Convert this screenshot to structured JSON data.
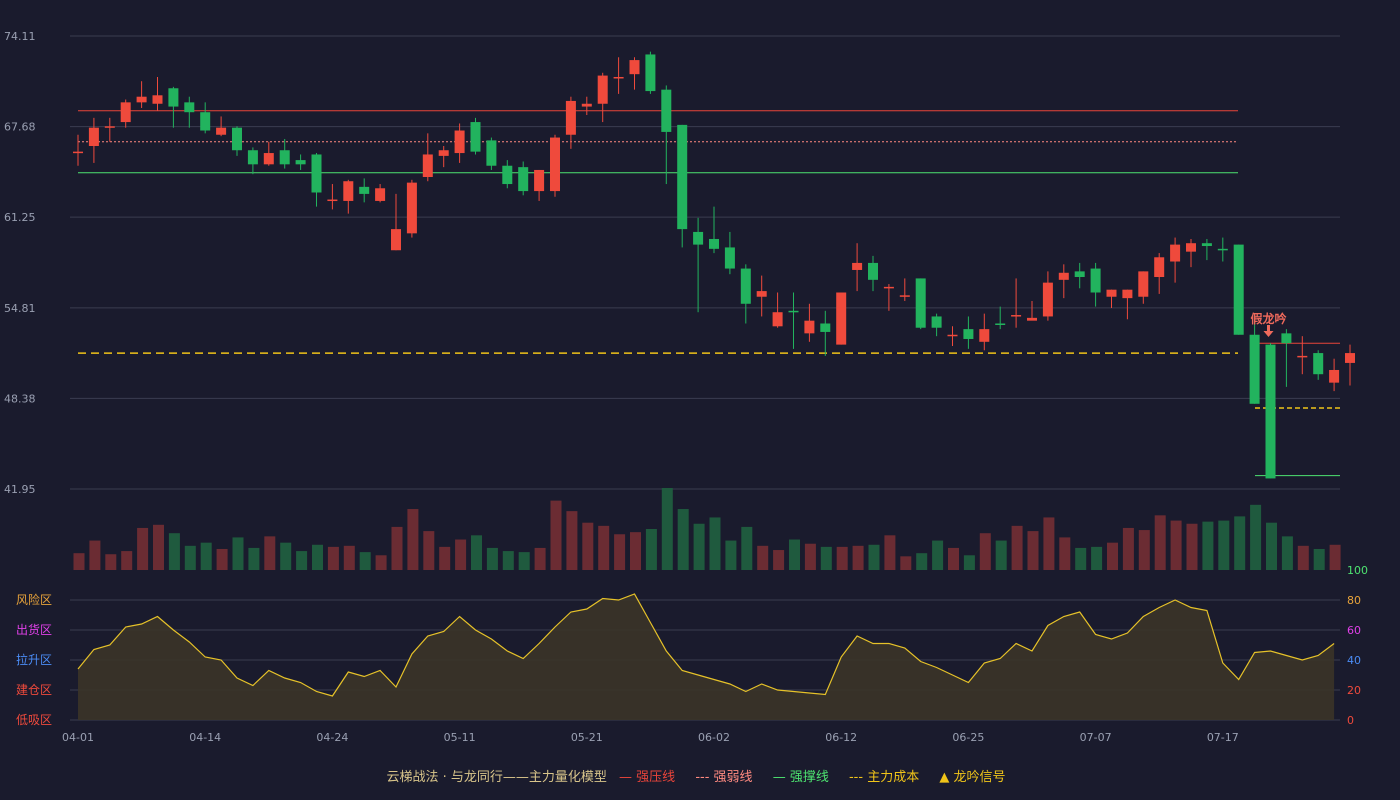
{
  "colors": {
    "background": "#1a1b2d",
    "grid": "#3a3c50",
    "up": "#ef4a3c",
    "down": "#22b35e",
    "pressure_line": "#e8443a",
    "weak_line": "#ff8a80",
    "support_line": "#4de370",
    "cost_line": "#f0c419",
    "indicator_line": "#e6c229",
    "indicator_fill": "#3b3428"
  },
  "chart_data": {
    "type": "candlestick",
    "price_ticks": [
      "74.11",
      "67.68",
      "61.25",
      "54.81",
      "48.38",
      "41.95"
    ],
    "ylim": [
      41.95,
      74.11
    ],
    "x_ticks": [
      {
        "index": 0,
        "label": "04-01"
      },
      {
        "index": 8,
        "label": "04-14"
      },
      {
        "index": 16,
        "label": "04-24"
      },
      {
        "index": 24,
        "label": "05-11"
      },
      {
        "index": 32,
        "label": "05-21"
      },
      {
        "index": 40,
        "label": "06-02"
      },
      {
        "index": 48,
        "label": "06-12"
      },
      {
        "index": 56,
        "label": "06-25"
      },
      {
        "index": 64,
        "label": "07-07"
      },
      {
        "index": 72,
        "label": "07-17"
      }
    ],
    "candles": [
      [
        65.9,
        65.9,
        67.1,
        64.9
      ],
      [
        66.3,
        67.6,
        68.3,
        65.1
      ],
      [
        67.6,
        67.7,
        68.3,
        66.6
      ],
      [
        68.0,
        69.4,
        69.6,
        67.6
      ],
      [
        69.4,
        69.8,
        70.9,
        69.0
      ],
      [
        69.3,
        69.9,
        71.2,
        68.8
      ],
      [
        70.4,
        69.1,
        70.5,
        67.6
      ],
      [
        69.4,
        68.7,
        69.8,
        67.6
      ],
      [
        68.7,
        67.4,
        69.4,
        67.2
      ],
      [
        67.1,
        67.6,
        68.4,
        67.0
      ],
      [
        67.6,
        66.0,
        67.7,
        65.6
      ],
      [
        66.0,
        65.0,
        66.2,
        64.3
      ],
      [
        65.0,
        65.8,
        66.6,
        64.9
      ],
      [
        66.0,
        65.0,
        66.8,
        64.7
      ],
      [
        65.3,
        65.0,
        65.7,
        64.6
      ],
      [
        65.7,
        63.0,
        65.8,
        62.0
      ],
      [
        62.4,
        62.5,
        63.6,
        61.8
      ],
      [
        62.4,
        63.8,
        63.9,
        61.5
      ],
      [
        63.4,
        62.9,
        64.0,
        62.3
      ],
      [
        62.4,
        63.3,
        63.6,
        62.3
      ],
      [
        58.9,
        60.4,
        62.9,
        58.9
      ],
      [
        60.1,
        63.7,
        63.9,
        59.8
      ],
      [
        64.1,
        65.7,
        67.2,
        63.8
      ],
      [
        65.6,
        66.0,
        66.3,
        64.8
      ],
      [
        65.8,
        67.4,
        67.9,
        65.1
      ],
      [
        68.0,
        65.9,
        68.3,
        65.7
      ],
      [
        66.7,
        64.9,
        66.9,
        64.6
      ],
      [
        64.9,
        63.6,
        65.3,
        63.3
      ],
      [
        64.8,
        63.1,
        65.2,
        62.8
      ],
      [
        63.1,
        64.6,
        64.6,
        62.4
      ],
      [
        63.1,
        66.9,
        67.1,
        62.7
      ],
      [
        67.1,
        69.5,
        69.8,
        66.1
      ],
      [
        69.1,
        69.3,
        69.8,
        68.5
      ],
      [
        69.3,
        71.3,
        71.5,
        68.0
      ],
      [
        71.2,
        71.2,
        72.6,
        70.0
      ],
      [
        71.4,
        72.4,
        72.6,
        70.3
      ],
      [
        72.8,
        70.2,
        73.0,
        70.0
      ],
      [
        70.3,
        67.3,
        70.6,
        63.6
      ],
      [
        67.8,
        60.4,
        67.8,
        59.1
      ],
      [
        60.2,
        59.3,
        61.2,
        54.5
      ],
      [
        59.7,
        59.0,
        62.0,
        58.7
      ],
      [
        59.1,
        57.6,
        60.2,
        57.2
      ],
      [
        57.6,
        55.1,
        57.9,
        53.7
      ],
      [
        55.6,
        56.0,
        57.1,
        54.2
      ],
      [
        53.5,
        54.5,
        55.9,
        53.4
      ],
      [
        54.6,
        54.5,
        55.9,
        51.9
      ],
      [
        53.0,
        53.9,
        55.1,
        52.4
      ],
      [
        53.7,
        53.1,
        54.6,
        51.4
      ],
      [
        52.2,
        55.9,
        55.9,
        52.2
      ],
      [
        57.5,
        58.0,
        59.4,
        56.0
      ],
      [
        58.0,
        56.8,
        58.5,
        56.0
      ],
      [
        56.2,
        56.3,
        56.5,
        54.6
      ],
      [
        55.6,
        55.7,
        56.9,
        55.3
      ],
      [
        56.9,
        53.4,
        56.9,
        53.3
      ],
      [
        54.2,
        53.4,
        54.4,
        52.8
      ],
      [
        52.8,
        52.9,
        53.5,
        52.1
      ],
      [
        53.3,
        52.6,
        54.2,
        51.9
      ],
      [
        52.4,
        53.3,
        54.4,
        51.8
      ],
      [
        53.7,
        53.6,
        54.9,
        53.3
      ],
      [
        54.3,
        54.3,
        56.9,
        53.4
      ],
      [
        53.9,
        54.1,
        55.3,
        54.0
      ],
      [
        54.2,
        56.6,
        57.4,
        53.9
      ],
      [
        56.8,
        57.3,
        57.9,
        55.5
      ],
      [
        57.4,
        57.0,
        58.0,
        56.2
      ],
      [
        57.6,
        55.9,
        58.0,
        54.9
      ],
      [
        55.6,
        56.1,
        56.1,
        54.8
      ],
      [
        55.5,
        56.1,
        56.1,
        54.0
      ],
      [
        55.6,
        57.4,
        57.4,
        55.1
      ],
      [
        57.0,
        58.4,
        58.7,
        55.8
      ],
      [
        58.1,
        59.3,
        59.8,
        56.6
      ],
      [
        58.8,
        59.4,
        59.7,
        57.7
      ],
      [
        59.4,
        59.2,
        59.7,
        58.2
      ],
      [
        59.0,
        58.9,
        59.8,
        58.1
      ],
      [
        59.3,
        52.9,
        59.3,
        52.9
      ],
      [
        52.9,
        48.0,
        53.9,
        48.0
      ],
      [
        52.2,
        42.7,
        52.3,
        42.7
      ],
      [
        53.0,
        52.3,
        53.3,
        49.2
      ],
      [
        51.4,
        51.4,
        52.8,
        50.1
      ],
      [
        51.6,
        50.1,
        51.8,
        49.7
      ],
      [
        49.5,
        50.4,
        51.2,
        48.9
      ],
      [
        50.9,
        51.6,
        52.2,
        49.3
      ]
    ],
    "volume": [
      16,
      28,
      15,
      18,
      40,
      43,
      35,
      23,
      26,
      20,
      31,
      21,
      32,
      26,
      18,
      24,
      22,
      23,
      17,
      14,
      41,
      58,
      37,
      22,
      29,
      33,
      21,
      18,
      17,
      21,
      66,
      56,
      45,
      42,
      34,
      36,
      39,
      78,
      58,
      44,
      50,
      28,
      41,
      23,
      19,
      29,
      25,
      22,
      22,
      23,
      24,
      33,
      13,
      16,
      28,
      21,
      14,
      35,
      28,
      42,
      37,
      50,
      31,
      21,
      22,
      26,
      40,
      38,
      52,
      47,
      44,
      46,
      47,
      51,
      62,
      45,
      32,
      23,
      20,
      24
    ],
    "indicator": {
      "name": "主力量化模型",
      "zone_labels": [
        "风险区",
        "出货区",
        "拉升区",
        "建仓区",
        "低吸区"
      ],
      "zone_colors": [
        "#e8a33a",
        "#e040e8",
        "#4b8cf5",
        "#ef4a3c",
        "#ef4a3c"
      ],
      "right_ticks": [
        "100",
        "80",
        "60",
        "40",
        "20",
        "0"
      ],
      "right_tick_colors": [
        "#4de370",
        "#e8a33a",
        "#e040e8",
        "#4b8cf5",
        "#ef4a3c",
        "#ef4a3c"
      ],
      "values": [
        34,
        47,
        50,
        62,
        64,
        69,
        60,
        52,
        42,
        40,
        28,
        23,
        33,
        28,
        25,
        19,
        16,
        32,
        29,
        33,
        22,
        44,
        56,
        59,
        69,
        60,
        54,
        46,
        41,
        51,
        62,
        72,
        74,
        81,
        80,
        84,
        65,
        46,
        33,
        30,
        27,
        24,
        19,
        24,
        20,
        19,
        18,
        17,
        42,
        56,
        51,
        51,
        48,
        39,
        35,
        30,
        25,
        38,
        41,
        51,
        46,
        63,
        69,
        72,
        57,
        54,
        58,
        69,
        75,
        80,
        75,
        73,
        38,
        27,
        45,
        46,
        43,
        40,
        43,
        51
      ],
      "ylim": [
        0,
        100
      ]
    },
    "levels": {
      "strong_pressure": 68.8,
      "weak_pressure": 66.6,
      "strong_support": 64.4,
      "main_cost": 51.6,
      "late_pressure": 52.3,
      "late_cost": 47.7,
      "late_support": 42.9
    },
    "signal": {
      "index": 75,
      "label": "假龙吟"
    }
  },
  "legend": {
    "prefix": "云梯战法 · 与龙同行——主力量化模型",
    "items": [
      {
        "symbol": "—",
        "label": "强压线",
        "color": "#e8443a"
      },
      {
        "symbol": "---",
        "label": "强弱线",
        "color": "#ff8a80"
      },
      {
        "symbol": "—",
        "label": "强撑线",
        "color": "#4de370"
      },
      {
        "symbol": "---",
        "label": "主力成本",
        "color": "#f0c419"
      },
      {
        "symbol": "▲",
        "label": "龙吟信号",
        "color": "#f0c419"
      }
    ]
  }
}
